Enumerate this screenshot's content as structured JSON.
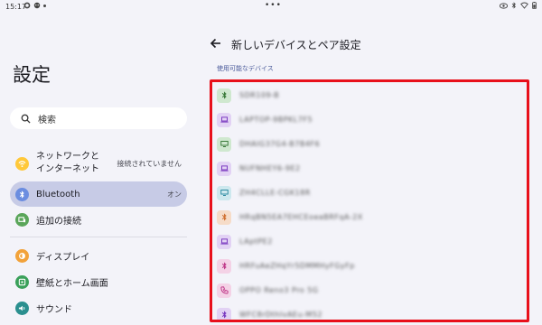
{
  "status_bar": {
    "time": "15:17",
    "dots": "•••",
    "icons_left": [
      "gear-icon",
      "face-icon",
      "notification-dot-icon"
    ],
    "icons_right": [
      "eye-icon",
      "bluetooth-icon",
      "wifi-icon",
      "battery-icon"
    ]
  },
  "settings_panel": {
    "title": "設定",
    "search_placeholder": "検索",
    "items": [
      {
        "label": "ネットワークと\nインターネット",
        "line1": "ネットワークと",
        "line2": "インターネット",
        "trailing": "接続されていません",
        "icon": "wifi-icon",
        "icon_bg": "#ffc83a"
      },
      {
        "label": "Bluetooth",
        "trailing": "オン",
        "icon": "bluetooth-icon",
        "icon_bg": "#6b8de0",
        "selected": true
      },
      {
        "label": "追加の接続",
        "trailing": "",
        "icon": "devices-icon",
        "icon_bg": "#5aa55a"
      },
      {
        "label": "ディスプレイ",
        "trailing": "",
        "icon": "brightness-icon",
        "icon_bg": "#f2a23a"
      },
      {
        "label": "壁紙とホーム画面",
        "trailing": "",
        "icon": "palette-icon",
        "icon_bg": "#3aa05a"
      },
      {
        "label": "サウンド",
        "trailing": "",
        "icon": "volume-icon",
        "icon_bg": "#2a8f8f"
      }
    ]
  },
  "pair_panel": {
    "title": "新しいデバイスとペア設定",
    "section_label": "使用可能なデバイス",
    "devices": [
      {
        "name": "SDR109-B",
        "icon": "bluetooth-icon",
        "icon_bg": "#cfe8cf",
        "icon_color": "#3a7a3a"
      },
      {
        "name": "LAPTOP-9BPKL7F5",
        "icon": "laptop-icon",
        "icon_bg": "#e2d2f4",
        "icon_color": "#7a3ac0"
      },
      {
        "name": "DHAIG37G4-B7B4F6",
        "icon": "monitor-icon",
        "icon_bg": "#cfe8cf",
        "icon_color": "#3a7a3a"
      },
      {
        "name": "NUFNHEY6-9E2",
        "icon": "laptop-icon",
        "icon_bg": "#e2d2f4",
        "icon_color": "#7a3ac0"
      },
      {
        "name": "ZH4CLLE-CGK18R",
        "icon": "monitor-icon",
        "icon_bg": "#cde8ee",
        "icon_color": "#2a8aa0"
      },
      {
        "name": "HRqBN5EA7EHCEoeaBRFqA-2X",
        "icon": "bluetooth-icon",
        "icon_bg": "#f6dcc8",
        "icon_color": "#d07030"
      },
      {
        "name": "LAptPE2",
        "icon": "laptop-icon",
        "icon_bg": "#e2d2f4",
        "icon_color": "#7a3ac0"
      },
      {
        "name": "HRFuAeZHqYr5DMMHyFGyFp",
        "icon": "bluetooth-icon",
        "icon_bg": "#f4d2e6",
        "icon_color": "#c03a8a"
      },
      {
        "name": "OPPO Reno3 Pro 5G",
        "icon": "phone-icon",
        "icon_bg": "#f4d2e6",
        "icon_color": "#c03a8a"
      },
      {
        "name": "WFC8rDthIvAEu-M52",
        "icon": "bluetooth-icon",
        "icon_bg": "#e2d2f4",
        "icon_color": "#7a3ac0"
      }
    ]
  }
}
